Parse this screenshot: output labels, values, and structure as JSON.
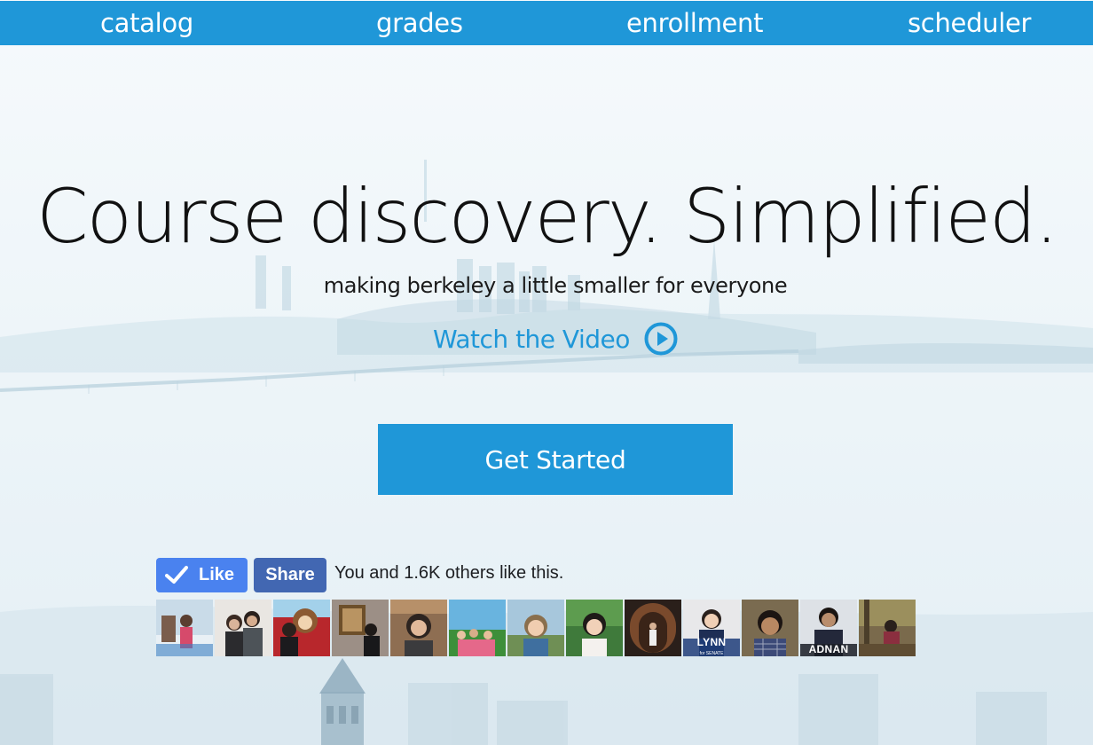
{
  "nav": {
    "items": [
      {
        "label": "catalog"
      },
      {
        "label": "grades"
      },
      {
        "label": "enrollment"
      },
      {
        "label": "scheduler"
      }
    ]
  },
  "hero": {
    "title": "Course discovery. Simplified.",
    "subtitle": "making berkeley a little smaller for everyone",
    "watch_video_label": "Watch the Video",
    "cta_label": "Get Started"
  },
  "facebook": {
    "like_label": "Like",
    "share_label": "Share",
    "social_text": "You and 1.6K others like this.",
    "faces": [
      {
        "label": ""
      },
      {
        "label": ""
      },
      {
        "label": ""
      },
      {
        "label": ""
      },
      {
        "label": ""
      },
      {
        "label": ""
      },
      {
        "label": ""
      },
      {
        "label": ""
      },
      {
        "label": ""
      },
      {
        "label": "LYNN",
        "sublabel": "for SENATE"
      },
      {
        "label": ""
      },
      {
        "label": "ADNAN"
      },
      {
        "label": ""
      }
    ]
  },
  "colors": {
    "accent": "#1f97d8",
    "fb_like": "#4a82ef",
    "fb_share": "#4267b2"
  }
}
